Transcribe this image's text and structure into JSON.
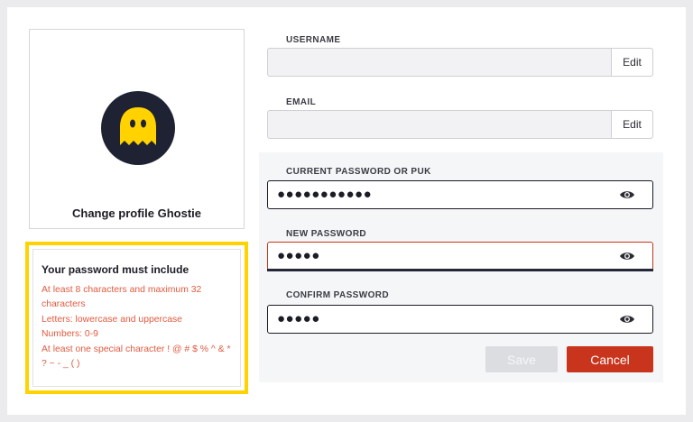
{
  "profile": {
    "caption": "Change profile Ghostie",
    "avatar_icon": "ghost-icon",
    "avatar_colors": {
      "circle": "#1f2233",
      "ghost": "#ffd200"
    }
  },
  "requirements": {
    "title": "Your password must include",
    "lines": [
      "At least 8 characters and maximum 32 characters",
      "Letters: lowercase and uppercase",
      "Numbers: 0-9",
      "At least one special character ! @ # $ % ^ & * ? ~ - _ ( )"
    ],
    "highlight_color": "#ffd200",
    "text_color": "#e15b40"
  },
  "username": {
    "label": "USERNAME",
    "value": "",
    "edit_label": "Edit"
  },
  "email": {
    "label": "EMAIL",
    "value": "",
    "edit_label": "Edit"
  },
  "current_password": {
    "label": "CURRENT PASSWORD OR PUK",
    "masked_value": "●●●●●●●●●●●",
    "icon": "eye-icon"
  },
  "new_password": {
    "label": "NEW PASSWORD",
    "masked_value": "●●●●●",
    "icon": "eye-icon"
  },
  "confirm_password": {
    "label": "CONFIRM PASSWORD",
    "masked_value": "●●●●●",
    "icon": "eye-icon"
  },
  "actions": {
    "save_label": "Save",
    "cancel_label": "Cancel",
    "save_enabled": false
  },
  "colors": {
    "accent": "#c9341d",
    "error_border": "#c9341d"
  }
}
